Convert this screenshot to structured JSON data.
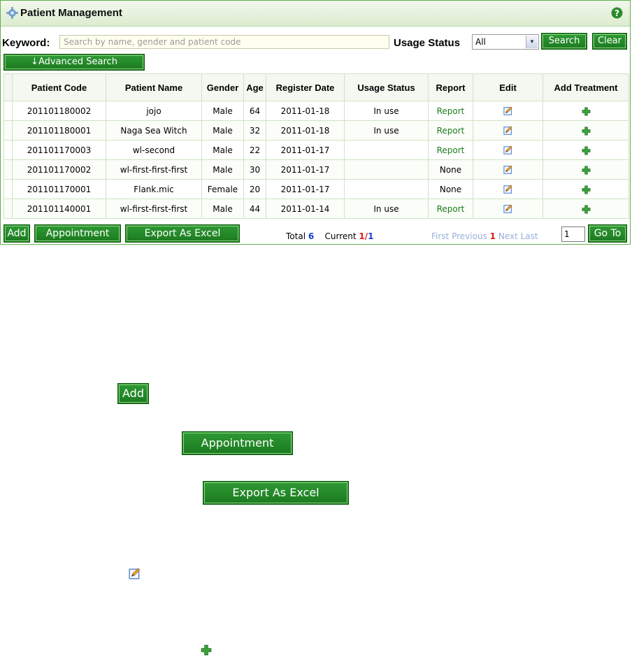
{
  "header": {
    "title": "Patient Management",
    "icon": "gear-icon",
    "help_icon": "help-icon"
  },
  "search": {
    "keyword_label": "Keyword:",
    "keyword_placeholder": "Search by name, gender and patient code",
    "keyword_value": "",
    "usage_status_label": "Usage Status",
    "usage_status_value": "All",
    "search_button": "Search",
    "clear_button": "Clear",
    "advanced_search_button": "↓Advanced Search"
  },
  "table": {
    "headers": [
      "",
      "Patient Code",
      "Patient Name",
      "Gender",
      "Age",
      "Register Date",
      "Usage Status",
      "Report",
      "Edit",
      "Add Treatment"
    ],
    "rows": [
      {
        "code": "201101180002",
        "name": "jojo",
        "gender": "Male",
        "age": "64",
        "date": "2011-01-18",
        "status": "In use",
        "report": "Report"
      },
      {
        "code": "201101180001",
        "name": "Naga Sea Witch",
        "gender": "Male",
        "age": "32",
        "date": "2011-01-18",
        "status": "In use",
        "report": "Report"
      },
      {
        "code": "201101170003",
        "name": "wl-second",
        "gender": "Male",
        "age": "22",
        "date": "2011-01-17",
        "status": "",
        "report": "Report"
      },
      {
        "code": "201101170002",
        "name": "wl-first-first-first",
        "gender": "Male",
        "age": "30",
        "date": "2011-01-17",
        "status": "",
        "report": "None"
      },
      {
        "code": "201101170001",
        "name": "Flank.mic",
        "gender": "Female",
        "age": "20",
        "date": "2011-01-17",
        "status": "",
        "report": "None"
      },
      {
        "code": "201101140001",
        "name": "wl-first-first-first",
        "gender": "Male",
        "age": "44",
        "date": "2011-01-14",
        "status": "In use",
        "report": "Report"
      }
    ],
    "edit_icon": "edit-icon",
    "add_treatment_icon": "plus-icon"
  },
  "footer": {
    "add_button": "Add",
    "appointment_button": "Appointment",
    "export_button": "Export As Excel",
    "total_label": "Total",
    "total_value": "6",
    "current_label": "Current",
    "current_page": "1",
    "current_sep": "/",
    "current_total": "1",
    "pager_first": "First",
    "pager_previous": "Previous",
    "pager_page": "1",
    "pager_next": "Next",
    "pager_last": "Last",
    "goto_value": "1",
    "goto_button": "Go To"
  },
  "legend": {
    "add_button": "Add",
    "appointment_button": "Appointment",
    "export_button": "Export As Excel",
    "edit_icon": "edit-icon",
    "plus_icon": "plus-icon"
  },
  "colors": {
    "button_green": "#1b7a1f",
    "border_green": "#5fae4a",
    "link_green": "#1f7d1f",
    "pager_blue": "#98b0da",
    "accent_red": "#e01818",
    "accent_blue": "#1a3fd0"
  }
}
